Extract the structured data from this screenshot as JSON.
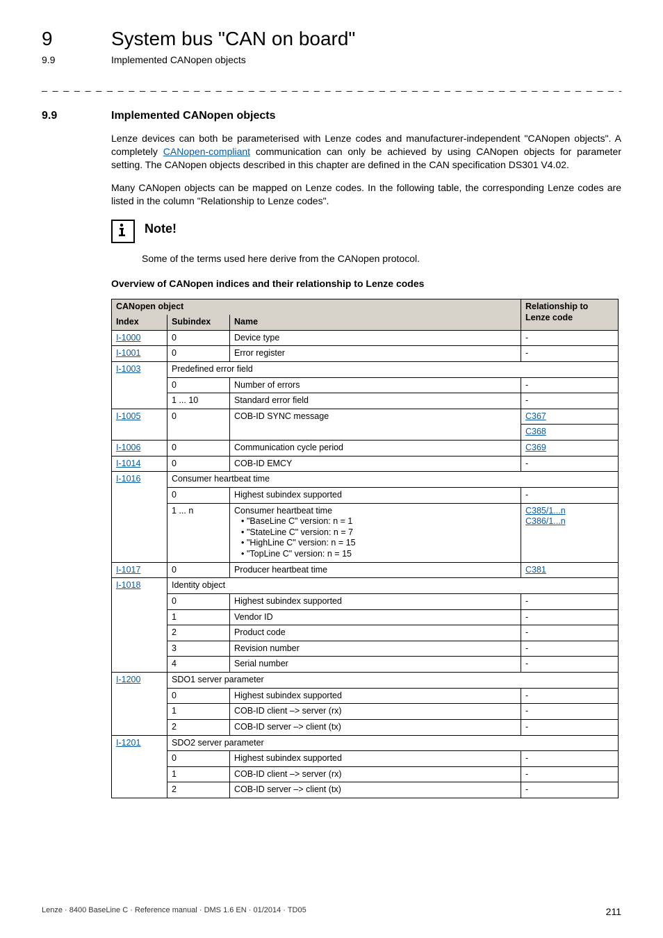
{
  "header": {
    "chapter_number": "9",
    "chapter_title": "System bus \"CAN on board\"",
    "section_number_top": "9.9",
    "section_title_top": "Implemented CANopen objects"
  },
  "dashes": "_ _ _ _ _ _ _ _ _ _ _ _ _ _ _ _ _ _ _ _ _ _ _ _ _ _ _ _ _ _ _ _ _ _ _ _ _ _ _ _ _ _ _ _ _ _ _ _ _ _ _ _ _ _ _ _ _ _ _ _ _ _ _",
  "section": {
    "number": "9.9",
    "title": "Implemented CANopen objects",
    "para1_a": "Lenze devices can both be parameterised with Lenze codes and manufacturer-independent \"CANopen objects\". A completely ",
    "para1_link": "CANopen-compliant",
    "para1_b": " communication can only be achieved by using CANopen objects for parameter setting. The CANopen objects described in this chapter are defined in the CAN specification DS301 V4.02.",
    "para2": "Many CANopen objects can be mapped on Lenze codes. In the following table, the corresponding Lenze codes are listed in the column \"Relationship to Lenze codes\"."
  },
  "note": {
    "label": "Note!",
    "text": "Some of the terms used here derive from the CANopen protocol."
  },
  "overview_heading": "Overview of CANopen indices and their relationship to Lenze codes",
  "table": {
    "header_group": "CANopen object",
    "header_rel": "Relationship to Lenze code",
    "header_index": "Index",
    "header_subindex": "Subindex",
    "header_name": "Name",
    "rows": [
      {
        "index": "I-1000",
        "index_link": true,
        "sub": "0",
        "name": "Device type",
        "rel": "-"
      },
      {
        "index": "I-1001",
        "index_link": true,
        "sub": "0",
        "name": "Error register",
        "rel": "-"
      },
      {
        "index": "I-1003",
        "index_link": true,
        "group": "Predefined error field"
      },
      {
        "index": "",
        "sub": "0",
        "name": "Number of errors",
        "rel": "-"
      },
      {
        "index": "",
        "sub": "1 ... 10",
        "name": "Standard error field",
        "rel": "-"
      },
      {
        "index": "I-1005",
        "index_link": true,
        "sub": "0",
        "name": "COB-ID SYNC message",
        "rel": "C367",
        "rel_link": true,
        "double_rel_second": "C368"
      },
      {
        "index": "I-1006",
        "index_link": true,
        "sub": "0",
        "name": "Communication cycle period",
        "rel": "C369",
        "rel_link": true
      },
      {
        "index": "I-1014",
        "index_link": true,
        "sub": "0",
        "name": "COB-ID EMCY",
        "rel": "-"
      },
      {
        "index": "I-1016",
        "index_link": true,
        "group": "Consumer heartbeat time"
      },
      {
        "index": "",
        "sub": "0",
        "name": "Highest subindex supported",
        "rel": "-"
      },
      {
        "index": "",
        "sub": "1 ... n",
        "name_block": {
          "lead": "Consumer heartbeat time",
          "items": [
            "\"BaseLine C\" version: n = 1",
            "\"StateLine C\" version: n = 7",
            "\"HighLine C\" version: n = 15",
            "\"TopLine C\" version: n = 15"
          ]
        },
        "rel_block": [
          "C385/1...n",
          "C386/1...n"
        ]
      },
      {
        "index": "I-1017",
        "index_link": true,
        "sub": "0",
        "name": "Producer heartbeat time",
        "rel": "C381",
        "rel_link": true
      },
      {
        "index": "I-1018",
        "index_link": true,
        "group": "Identity object"
      },
      {
        "index": "",
        "sub": "0",
        "name": "Highest subindex supported",
        "rel": "-"
      },
      {
        "index": "",
        "sub": "1",
        "name": "Vendor ID",
        "rel": "-"
      },
      {
        "index": "",
        "sub": "2",
        "name": "Product code",
        "rel": "-"
      },
      {
        "index": "",
        "sub": "3",
        "name": "Revision number",
        "rel": "-"
      },
      {
        "index": "",
        "sub": "4",
        "name": "Serial number",
        "rel": "-"
      },
      {
        "index": "I-1200",
        "index_link": true,
        "group": "SDO1 server parameter"
      },
      {
        "index": "",
        "sub": "0",
        "name": "Highest subindex supported",
        "rel": "-"
      },
      {
        "index": "",
        "sub": "1",
        "name": "COB-ID client –> server (rx)",
        "rel": "-"
      },
      {
        "index": "",
        "sub": "2",
        "name": "COB-ID server –> client (tx)",
        "rel": "-"
      },
      {
        "index": "I-1201",
        "index_link": true,
        "group": "SDO2 server parameter"
      },
      {
        "index": "",
        "sub": "0",
        "name": "Highest subindex supported",
        "rel": "-"
      },
      {
        "index": "",
        "sub": "1",
        "name": "COB-ID client –> server (rx)",
        "rel": "-"
      },
      {
        "index": "",
        "sub": "2",
        "name": "COB-ID server –> client (tx)",
        "rel": "-"
      }
    ]
  },
  "footer": {
    "left": "Lenze · 8400 BaseLine C · Reference manual · DMS 1.6 EN · 01/2014 · TD05",
    "right": "211"
  }
}
